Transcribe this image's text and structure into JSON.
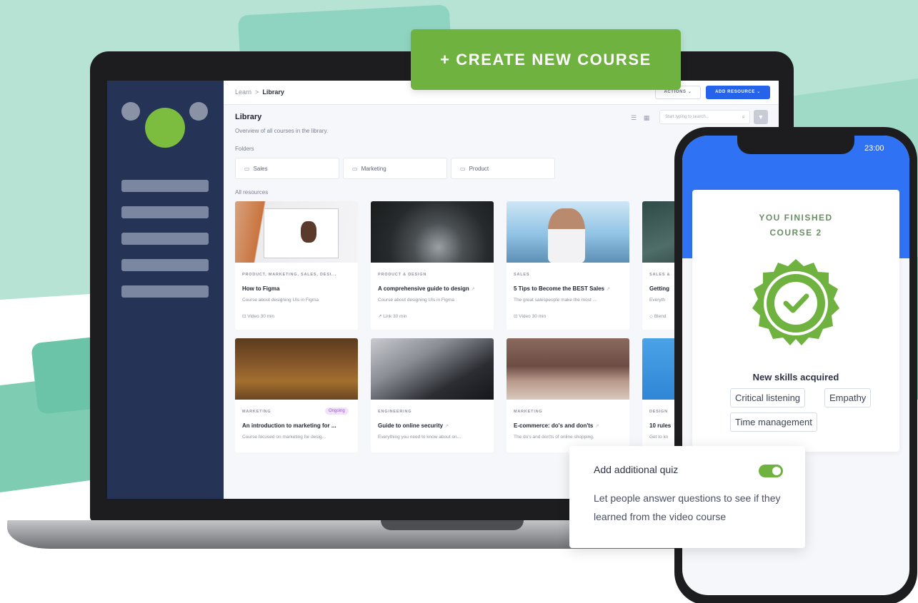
{
  "promo": {
    "create_button_label": "+ CREATE NEW COURSE",
    "brand_green": "#6fb23f",
    "brand_blue": "#2563eb"
  },
  "breadcrumb": {
    "parent": "Learn",
    "separator": ">",
    "current": "Library"
  },
  "toolbar": {
    "actions_label": "ACTIONS",
    "add_resource_label": "ADD RESOURCE"
  },
  "library": {
    "title": "Library",
    "subtitle": "Overview of all courses in the library.",
    "search_placeholder": "Start typing to search...",
    "folders_label": "Folders",
    "folders": [
      "Sales",
      "Marketing",
      "Product"
    ],
    "all_resources_label": "All resources",
    "cards": [
      {
        "category": "PRODUCT, MARKETING, SALES, DESI...",
        "title": "How to Figma",
        "desc": "Course about designing UIs in Figma",
        "meta": "Video   30 min",
        "type_icon": "video-icon"
      },
      {
        "category": "PRODUCT & DESIGN",
        "title": "A comprehensive guide to design",
        "desc": "Course about designing UIs in Figma",
        "meta": "Link   30 min",
        "type_icon": "link-icon"
      },
      {
        "category": "SALES",
        "title": "5 Tips to Become the BEST Sales",
        "desc": "The great salespeople make the most ...",
        "meta": "Video   30 min",
        "type_icon": "video-icon"
      },
      {
        "category": "SALES &",
        "title": "Getting",
        "desc": "Everyth",
        "meta": "Blend",
        "type_icon": "blend-icon"
      },
      {
        "category": "MARKETING",
        "title": "An introduction to marketing for ...",
        "desc": "Course focused on marketing for desig...",
        "badge": "Ongoing"
      },
      {
        "category": "ENGINEERING",
        "title": "Guide to online security",
        "desc": "Everything you need to know about on..."
      },
      {
        "category": "MARKETING",
        "title": "E-commerce: do's and don'ts",
        "desc": "The do's and don'ts of online shopping."
      },
      {
        "category": "DESIGN",
        "title": "10 rules",
        "desc": "Get to kn"
      }
    ]
  },
  "phone": {
    "time": "23:00",
    "finished_line1": "YOU FINISHED",
    "finished_line2": "COURSE 2",
    "skills_title": "New skills acquired",
    "skills": [
      "Critical listening",
      "Empathy",
      "Time management"
    ]
  },
  "quiz": {
    "title": "Add additional quiz",
    "toggle_on": true,
    "description": "Let people answer questions to see if they learned from the video course"
  }
}
